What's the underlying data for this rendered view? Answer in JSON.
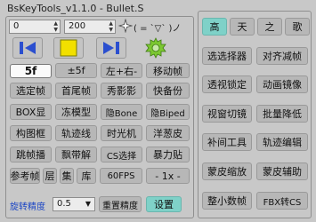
{
  "window": {
    "title": "BsKeyTools_v1.1.0 - Bullet.S"
  },
  "left": {
    "spin_start": "0",
    "spin_end": "200",
    "emote": "( = `▽` )ノ",
    "key_field_value": "5f",
    "rows": [
      [
        "±5f",
        "左+右-",
        "移动帧"
      ],
      [
        "选定帧",
        "首尾帧",
        "秀影影",
        "快备份"
      ],
      [
        "BOX显",
        "冻模型",
        "隐Bone",
        "隐Biped"
      ],
      [
        "构图框",
        "轨迹线",
        "时光机",
        "洋葱皮"
      ],
      [
        "跳帧播",
        "飘带解",
        "CS选择",
        "暴力贴"
      ],
      [
        "参考帧",
        "层",
        "集",
        "库",
        "60FPS",
        "- 1x -"
      ]
    ],
    "precision_label": "旋转精度",
    "precision_value": "0.5",
    "reset_precision": "重置精度",
    "settings": "设置"
  },
  "right": {
    "tabs": [
      "高",
      "天",
      "之",
      "歌"
    ],
    "buttons": [
      [
        "选选择器",
        "对齐减帧"
      ],
      [
        "透视锁定",
        "动画镜像"
      ],
      [
        "视窗切镜",
        "批量降低"
      ],
      [
        "补间工具",
        "轨迹编辑"
      ],
      [
        "蒙皮缩放",
        "蒙皮辅助"
      ],
      [
        "整小数帧",
        "FBX转CS"
      ]
    ]
  },
  "colors": {
    "teal": "#7fd1c8",
    "bg": "#c8c8c8",
    "button": "#b7b7b7",
    "blue": "#2b4fcf",
    "yellow": "#f2e000",
    "green": "#7dc832"
  }
}
